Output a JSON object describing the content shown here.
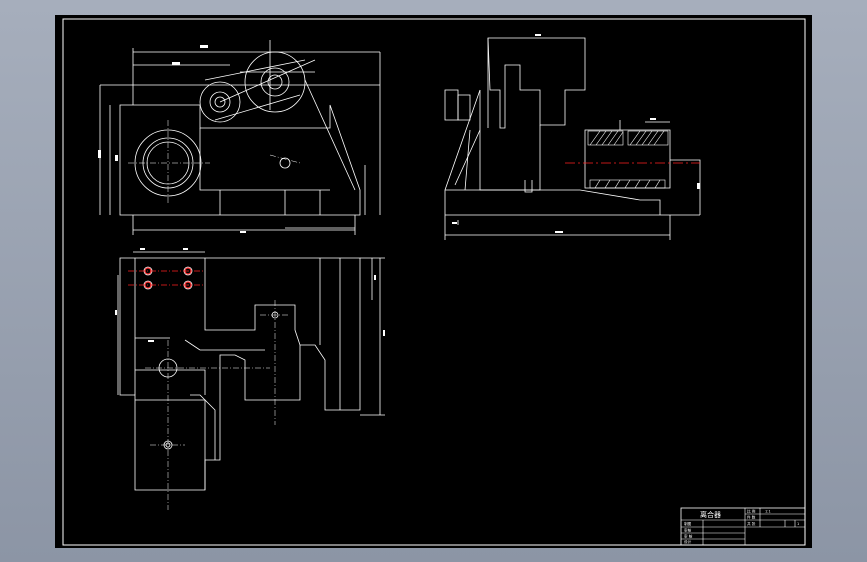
{
  "colors": {
    "viewport_bg": "#99a1b0",
    "sheet_bg": "#000000",
    "line": "#ffffff",
    "centerline": "#ff2020"
  },
  "title_block": {
    "part_name": "离合器",
    "scale_label": "比 例",
    "scale_value": "1:1",
    "qty_label": "件 数",
    "sheet_label": "共 张",
    "sheet_value": "1",
    "drawn_label": "制图",
    "checked_label": "审核",
    "approved_label": "审 核",
    "design_label": "设计"
  }
}
